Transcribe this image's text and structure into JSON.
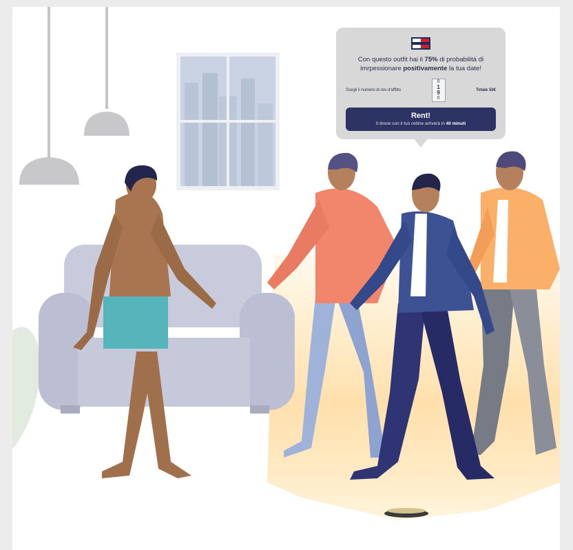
{
  "bubble": {
    "message_prefix": "Con questo outfit hai il ",
    "probability": "75%",
    "message_mid": " di probabilità di imrpessionare ",
    "positive_word": "positivamente",
    "message_suffix": " la tua date!",
    "hours_label": "Scegli il numero di ore d'affitto",
    "hours_values": [
      "0",
      "1",
      "9",
      "0"
    ],
    "total_label": "Totale",
    "total_value": "50€",
    "rent_button": "Rent!",
    "rent_sub_prefix": "Il drone con il tuo ordine arriverà in ",
    "rent_sub_time": "40 minuti"
  },
  "colors": {
    "bubble_bg": "#d8d8d8",
    "button_bg": "#2d3463",
    "accent_text": "#2b2f4a"
  },
  "icons": {
    "brand_flag": "tommy-flag-icon"
  }
}
